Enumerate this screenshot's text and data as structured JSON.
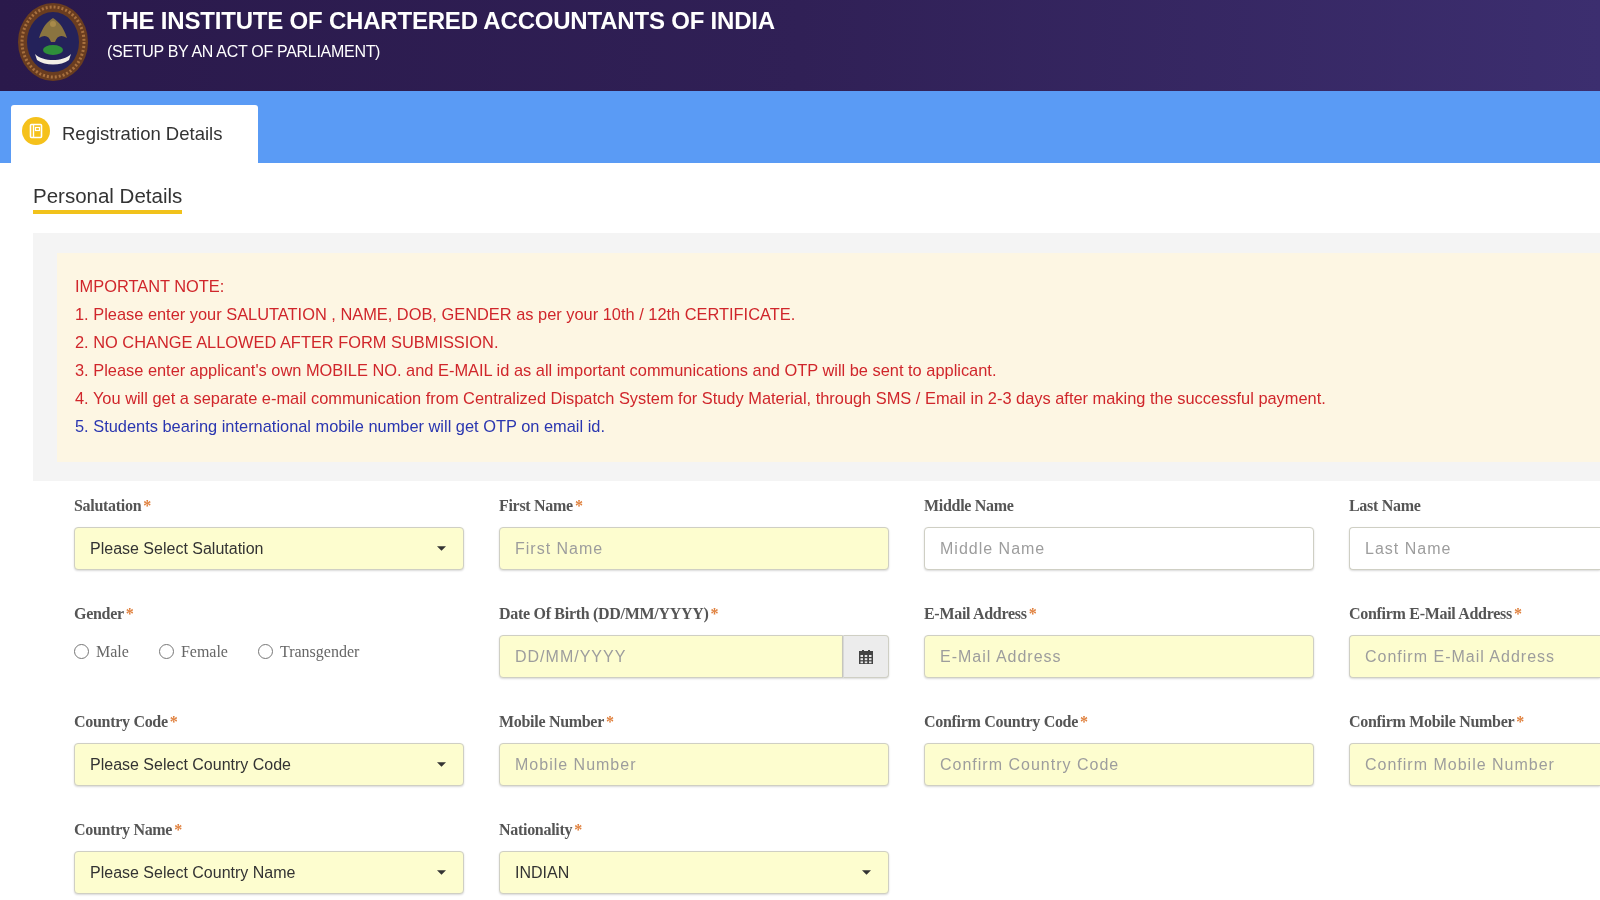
{
  "header": {
    "title": "THE INSTITUTE OF CHARTERED ACCOUNTANTS OF INDIA",
    "subtitle": "(SETUP BY AN ACT OF PARLIAMENT)"
  },
  "tabs": [
    {
      "label": "Registration Details",
      "selected": true
    }
  ],
  "section": {
    "title": "Personal Details"
  },
  "important_note": {
    "lines": [
      {
        "text": "IMPORTANT NOTE:",
        "color": "#d0262b"
      },
      {
        "text": "1. Please enter your SALUTATION , NAME, DOB, GENDER as per your 10th / 12th CERTIFICATE.",
        "color": "#d0262b"
      },
      {
        "text": "2. NO CHANGE ALLOWED AFTER FORM SUBMISSION.",
        "color": "#d0262b"
      },
      {
        "text": "3. Please enter applicant's own MOBILE NO. and E-MAIL id as all important communications and OTP will be sent to applicant.",
        "color": "#d0262b"
      },
      {
        "text": "4. You will get a separate e-mail communication from Centralized Dispatch System for Study Material, through SMS / Email in 2-3 days after making the successful payment.",
        "color": "#d0262b"
      },
      {
        "text": "5. Students bearing international mobile number will get OTP on email id.",
        "color": "#2a36b0"
      }
    ]
  },
  "form": {
    "rows": [
      [
        {
          "kind": "select",
          "label": "Salutation",
          "required": true,
          "required_mark": "*",
          "value": "Please Select Salutation"
        },
        {
          "kind": "text",
          "label": "First Name",
          "required": true,
          "required_mark": "*",
          "placeholder": "First Name"
        },
        {
          "kind": "text",
          "label": "Middle Name",
          "required": false,
          "placeholder": "Middle Name"
        },
        {
          "kind": "text",
          "label": "Last Name",
          "required": false,
          "placeholder": "Last Name"
        }
      ],
      [
        {
          "kind": "radio",
          "label": "Gender",
          "required": true,
          "required_mark": "*",
          "options": [
            {
              "label": "Male",
              "selected": false
            },
            {
              "label": "Female",
              "selected": false
            },
            {
              "label": "Transgender",
              "selected": false
            }
          ]
        },
        {
          "kind": "date",
          "label": "Date Of Birth (DD/MM/YYYY)",
          "required": true,
          "required_mark": "*",
          "placeholder": "DD/MM/YYYY"
        },
        {
          "kind": "text",
          "label": "E-Mail Address",
          "required": true,
          "required_mark": "*",
          "placeholder": "E-Mail Address"
        },
        {
          "kind": "text",
          "label": "Confirm E-Mail Address",
          "required": true,
          "required_mark": "*",
          "placeholder": "Confirm E-Mail Address"
        }
      ],
      [
        {
          "kind": "select",
          "label": "Country Code",
          "required": true,
          "required_mark": "*",
          "value": "Please Select Country Code"
        },
        {
          "kind": "text",
          "label": "Mobile Number",
          "required": true,
          "required_mark": "*",
          "placeholder": "Mobile Number"
        },
        {
          "kind": "text",
          "label": "Confirm Country Code",
          "required": true,
          "required_mark": "*",
          "placeholder": "Confirm Country Code"
        },
        {
          "kind": "text",
          "label": "Confirm Mobile Number",
          "required": true,
          "required_mark": "*",
          "placeholder": "Confirm Mobile Number"
        }
      ],
      [
        {
          "kind": "select",
          "label": "Country Name",
          "required": true,
          "required_mark": "*",
          "value": "Please Select Country Name"
        },
        {
          "kind": "select",
          "label": "Nationality",
          "required": true,
          "required_mark": "*",
          "value": "INDIAN"
        }
      ]
    ]
  }
}
